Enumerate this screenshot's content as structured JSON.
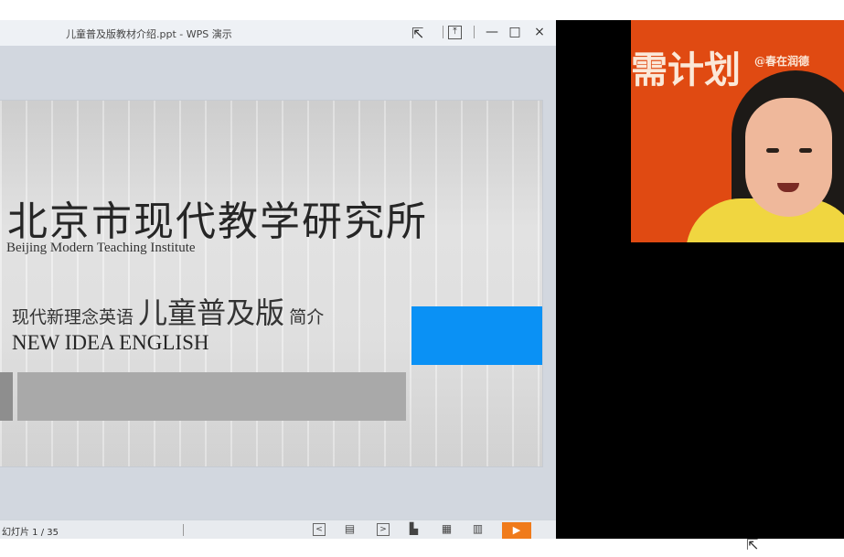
{
  "window": {
    "title": "儿童普及版教材介绍.ppt - WPS 演示",
    "controls": {
      "minimize": "—",
      "maximize": "□",
      "close": "×",
      "pin": "⤒"
    }
  },
  "slide": {
    "title_cn": "北京市现代教学研究所",
    "title_en": "Beijing Modern Teaching Institute",
    "line1_prefix": "现代新理念英语",
    "line1_big": "儿童普及版",
    "line1_suffix": "简介",
    "line2": "NEW IDEA ENGLISH",
    "accent_color": "#0a91f5"
  },
  "statusbar": {
    "slide_counter": "幻灯片 1 / 35",
    "buttons": {
      "prev": "<",
      "next": ">",
      "play": "▶"
    },
    "play_color": "#f07b1b"
  },
  "webcam": {
    "banner_text": "需计划",
    "banner_small": "@春在润德"
  }
}
